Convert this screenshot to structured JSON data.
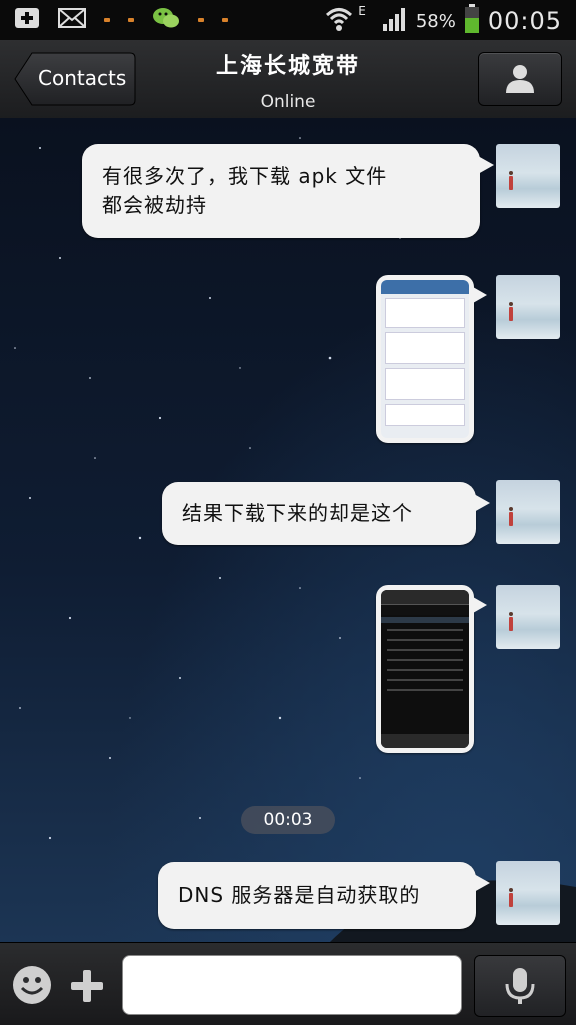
{
  "status_bar": {
    "battery_percent": "58%",
    "time": "00:05",
    "network_type": "E",
    "icons": [
      "add-icon",
      "mail-icon",
      "wechat-icon",
      "wifi-icon",
      "signal-icon",
      "battery-icon"
    ]
  },
  "header": {
    "back_label": "Contacts",
    "title": "上海长城宽带",
    "subtitle": "Online"
  },
  "messages": [
    {
      "type": "text",
      "lines": [
        "有很多次了，我下载 apk 文件",
        "都会被劫持"
      ]
    },
    {
      "type": "image",
      "theme": "light"
    },
    {
      "type": "text",
      "lines": [
        "结果下载下来的却是这个"
      ]
    },
    {
      "type": "image",
      "theme": "dark"
    },
    {
      "type": "text",
      "lines": [
        "DNS 服务器是自动获取的"
      ]
    }
  ],
  "timestamp": "00:03",
  "input": {
    "value": "",
    "placeholder": ""
  },
  "colors": {
    "bubble": "#f2f2f2",
    "bar": "#1c1d1f",
    "battery": "#5fb82e"
  }
}
